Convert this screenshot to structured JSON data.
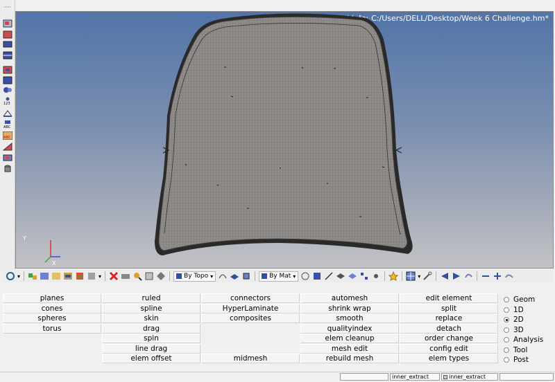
{
  "viewport": {
    "model_info_label": "Model Info:",
    "model_info_path": "C:/Users/DELL/Desktop/Week 6 Challenge.hm*"
  },
  "triad": {
    "y_label": "Y",
    "x_label": "X"
  },
  "toolbar": {
    "by_topo_label": "By Topo",
    "by_mat_label": "By Mat"
  },
  "panel": {
    "col1": [
      "planes",
      "cones",
      "spheres",
      "torus",
      "",
      "",
      ""
    ],
    "col2": [
      "ruled",
      "spline",
      "skin",
      "drag",
      "spin",
      "line drag",
      "elem offset"
    ],
    "col3": [
      "connectors",
      "HyperLaminate",
      "composites",
      "",
      "",
      "",
      "midmesh"
    ],
    "col4": [
      "automesh",
      "shrink wrap",
      "smooth",
      "qualityindex",
      "elem cleanup",
      "mesh edit",
      "rebuild mesh"
    ],
    "col5": [
      "edit element",
      "split",
      "replace",
      "detach",
      "order change",
      "config edit",
      "elem types"
    ]
  },
  "pages": [
    {
      "label": "Geom",
      "selected": false
    },
    {
      "label": "1D",
      "selected": false
    },
    {
      "label": "2D",
      "selected": true
    },
    {
      "label": "3D",
      "selected": false
    },
    {
      "label": "Analysis",
      "selected": false
    },
    {
      "label": "Tool",
      "selected": false
    },
    {
      "label": "Post",
      "selected": false
    }
  ],
  "status": {
    "field1": "",
    "field2": "inner_extract",
    "field3": "inner_extract",
    "field4": ""
  },
  "colors": {
    "viewport_top": "#5274a8",
    "viewport_bottom": "#c3c3c7",
    "mesh_fill": "#8f8c8a",
    "mesh_edge": "#2a2a2a"
  }
}
